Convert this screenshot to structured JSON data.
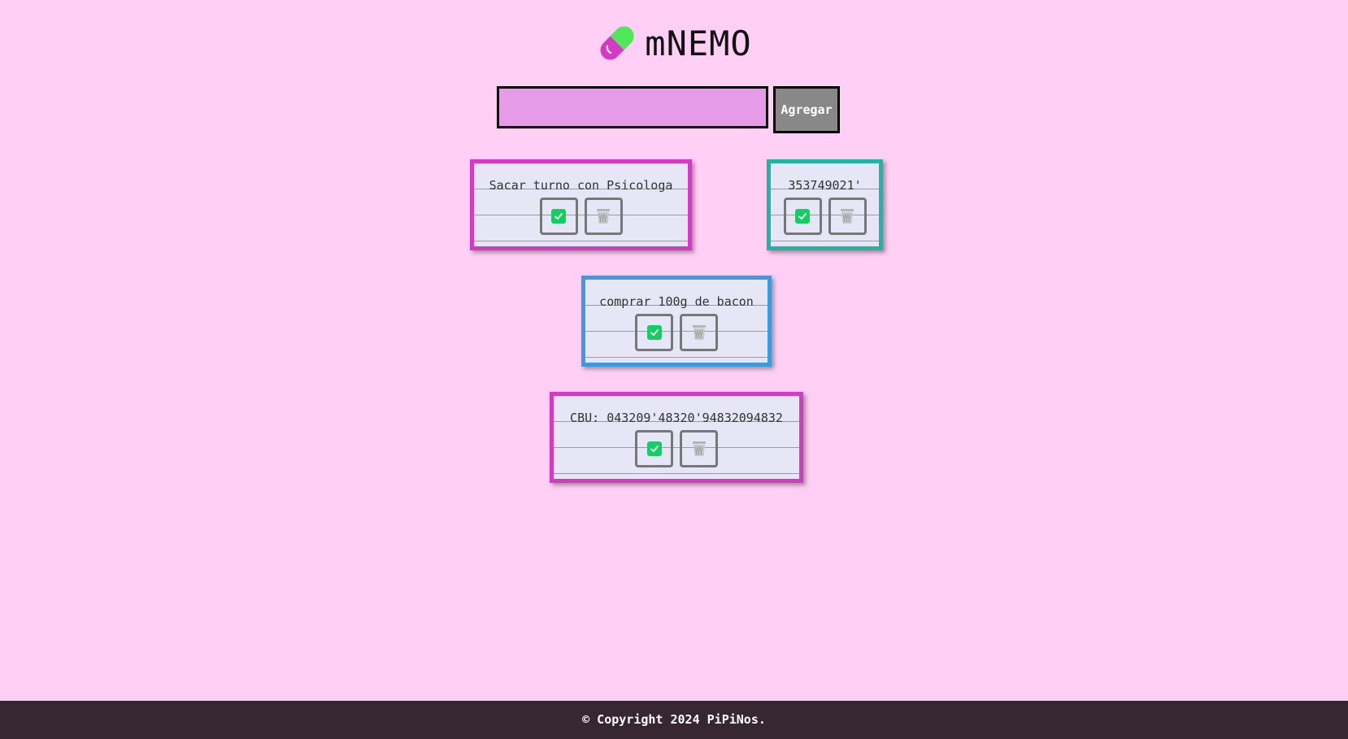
{
  "app": {
    "title": "mNEMO",
    "logo_icon": "pill-icon"
  },
  "add_form": {
    "input_value": "",
    "placeholder": "",
    "button_label": "Agregar"
  },
  "colors": {
    "background": "#ffcff5",
    "input_bg": "#e69be8",
    "button_bg": "#888888",
    "note_bg": "#e6e6f7",
    "check_green": "#13cf63",
    "footer_bg": "#372732"
  },
  "notes": [
    {
      "text": "Sacar turno con Psicologa",
      "border_color": "#d53ac4",
      "complete_icon": "check-icon",
      "delete_icon": "trash-icon"
    },
    {
      "text": "353749021'",
      "border_color": "#20b4a3",
      "complete_icon": "check-icon",
      "delete_icon": "trash-icon"
    },
    {
      "text": "comprar 100g de bacon",
      "border_color": "#3a9be1",
      "complete_icon": "check-icon",
      "delete_icon": "trash-icon"
    },
    {
      "text": "CBU: 043209'48320'94832094832",
      "border_color": "#d53ac4",
      "complete_icon": "check-icon",
      "delete_icon": "trash-icon"
    }
  ],
  "footer": {
    "text": "© Copyright 2024 PiPiNos."
  }
}
